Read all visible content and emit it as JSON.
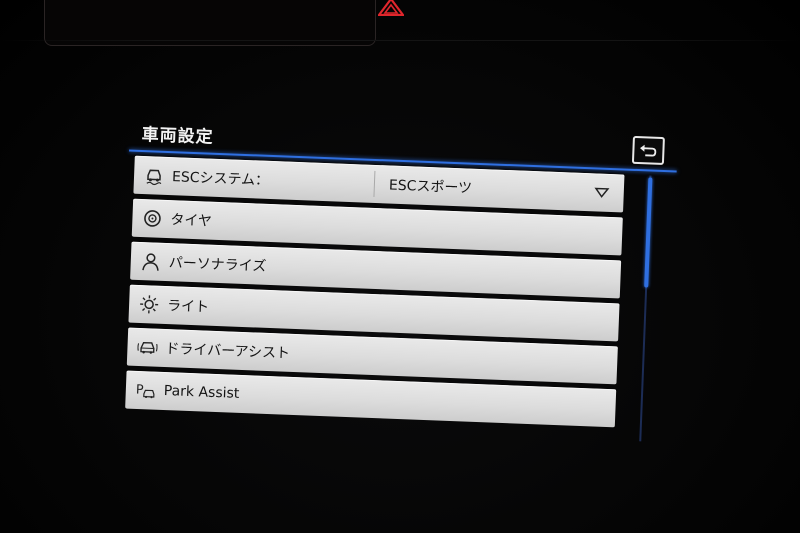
{
  "screen": {
    "title": "車両設定",
    "back_icon": "back-arrow-icon",
    "accent_color": "#2f6fe0"
  },
  "menu": {
    "items": [
      {
        "id": "esc",
        "icon": "esc-car-icon",
        "label": "ESCシステム：",
        "value": "ESCスポーツ"
      },
      {
        "id": "tires",
        "icon": "tire-icon",
        "label": "タイヤ"
      },
      {
        "id": "personalize",
        "icon": "person-icon",
        "label": "パーソナライズ"
      },
      {
        "id": "lights",
        "icon": "light-bulb-icon",
        "label": "ライト"
      },
      {
        "id": "driver-assist",
        "icon": "driver-assist-icon",
        "label": "ドライバーアシスト"
      },
      {
        "id": "park-assist",
        "icon": "park-assist-icon",
        "label": "Park Assist"
      }
    ]
  },
  "dashboard": {
    "hazard_icon": "hazard-warning-icon",
    "hazard_color": "#e0262c"
  }
}
